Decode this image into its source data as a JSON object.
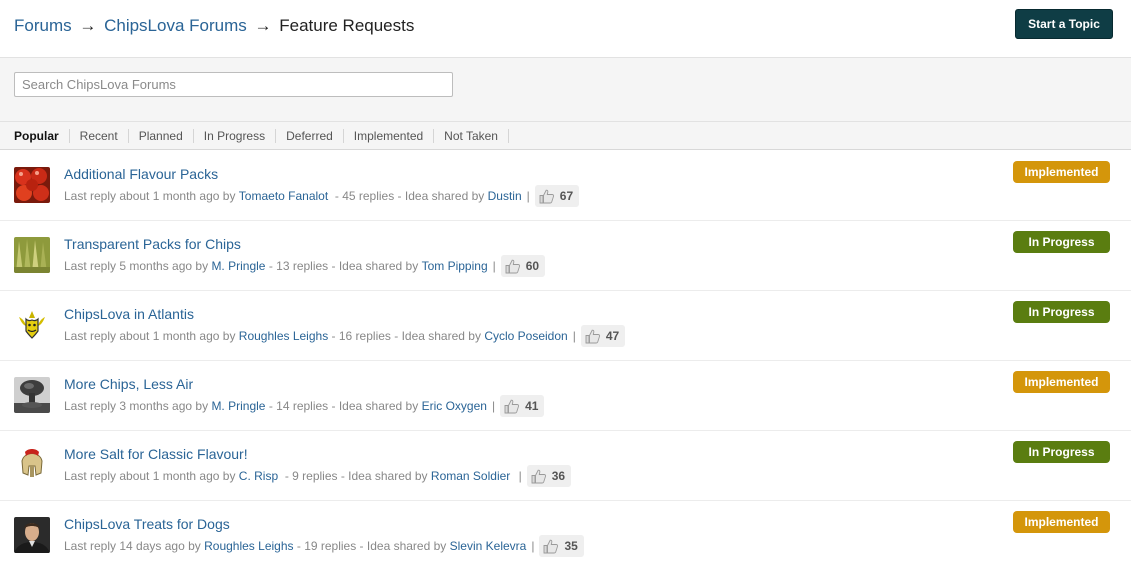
{
  "breadcrumb": {
    "root": "Forums",
    "arrow": "→",
    "forum": "ChipsLova Forums",
    "current": "Feature Requests"
  },
  "actions": {
    "start_topic": "Start a Topic"
  },
  "search": {
    "placeholder": "Search ChipsLova Forums",
    "value": ""
  },
  "tabs": [
    {
      "label": "Popular",
      "active": true
    },
    {
      "label": "Recent",
      "active": false
    },
    {
      "label": "Planned",
      "active": false
    },
    {
      "label": "In Progress",
      "active": false
    },
    {
      "label": "Deferred",
      "active": false
    },
    {
      "label": "Implemented",
      "active": false
    },
    {
      "label": "Not Taken",
      "active": false
    }
  ],
  "status_colors": {
    "Implemented": "#d4960b",
    "In Progress": "#5a7d10"
  },
  "topics": [
    {
      "title": "Additional Flavour Packs",
      "last_reply": "Last reply about 1 month ago by",
      "last_user": "Tomaeto Fanalot",
      "replies": "- 45 replies - Idea shared by",
      "shared_by": "Dustin",
      "votes": "67",
      "status": "Implemented",
      "avatar": "tomatoes-avatar"
    },
    {
      "title": "Transparent Packs for Chips",
      "last_reply": "Last reply 5 months ago by",
      "last_user": "M. Pringle",
      "replies": "- 13 replies - Idea shared by",
      "shared_by": "Tom Pipping",
      "votes": "60",
      "status": "In Progress",
      "avatar": "chips-avatar"
    },
    {
      "title": "ChipsLova in Atlantis",
      "last_reply": "Last reply about 1 month ago by",
      "last_user": "Roughles Leighs",
      "replies": "- 16 replies - Idea shared by",
      "shared_by": "Cyclo Poseidon",
      "votes": "47",
      "status": "In Progress",
      "avatar": "trident-emblem-avatar"
    },
    {
      "title": "More Chips, Less Air",
      "last_reply": "Last reply 3 months ago by",
      "last_user": "M. Pringle",
      "replies": "- 14 replies - Idea shared by",
      "shared_by": "Eric Oxygen",
      "votes": "41",
      "status": "Implemented",
      "avatar": "mushroom-cloud-avatar"
    },
    {
      "title": "More Salt for Classic Flavour!",
      "last_reply": "Last reply about 1 month ago by",
      "last_user": "C. Risp",
      "replies": "- 9 replies - Idea shared by",
      "shared_by": "Roman Soldier",
      "votes": "36",
      "status": "In Progress",
      "avatar": "roman-helmet-avatar"
    },
    {
      "title": "ChipsLova Treats for Dogs",
      "last_reply": "Last reply 14 days ago by",
      "last_user": "Roughles Leighs",
      "replies": "- 19 replies - Idea shared by",
      "shared_by": "Slevin Kelevra",
      "votes": "35",
      "status": "Implemented",
      "avatar": "person-photo-avatar"
    }
  ]
}
